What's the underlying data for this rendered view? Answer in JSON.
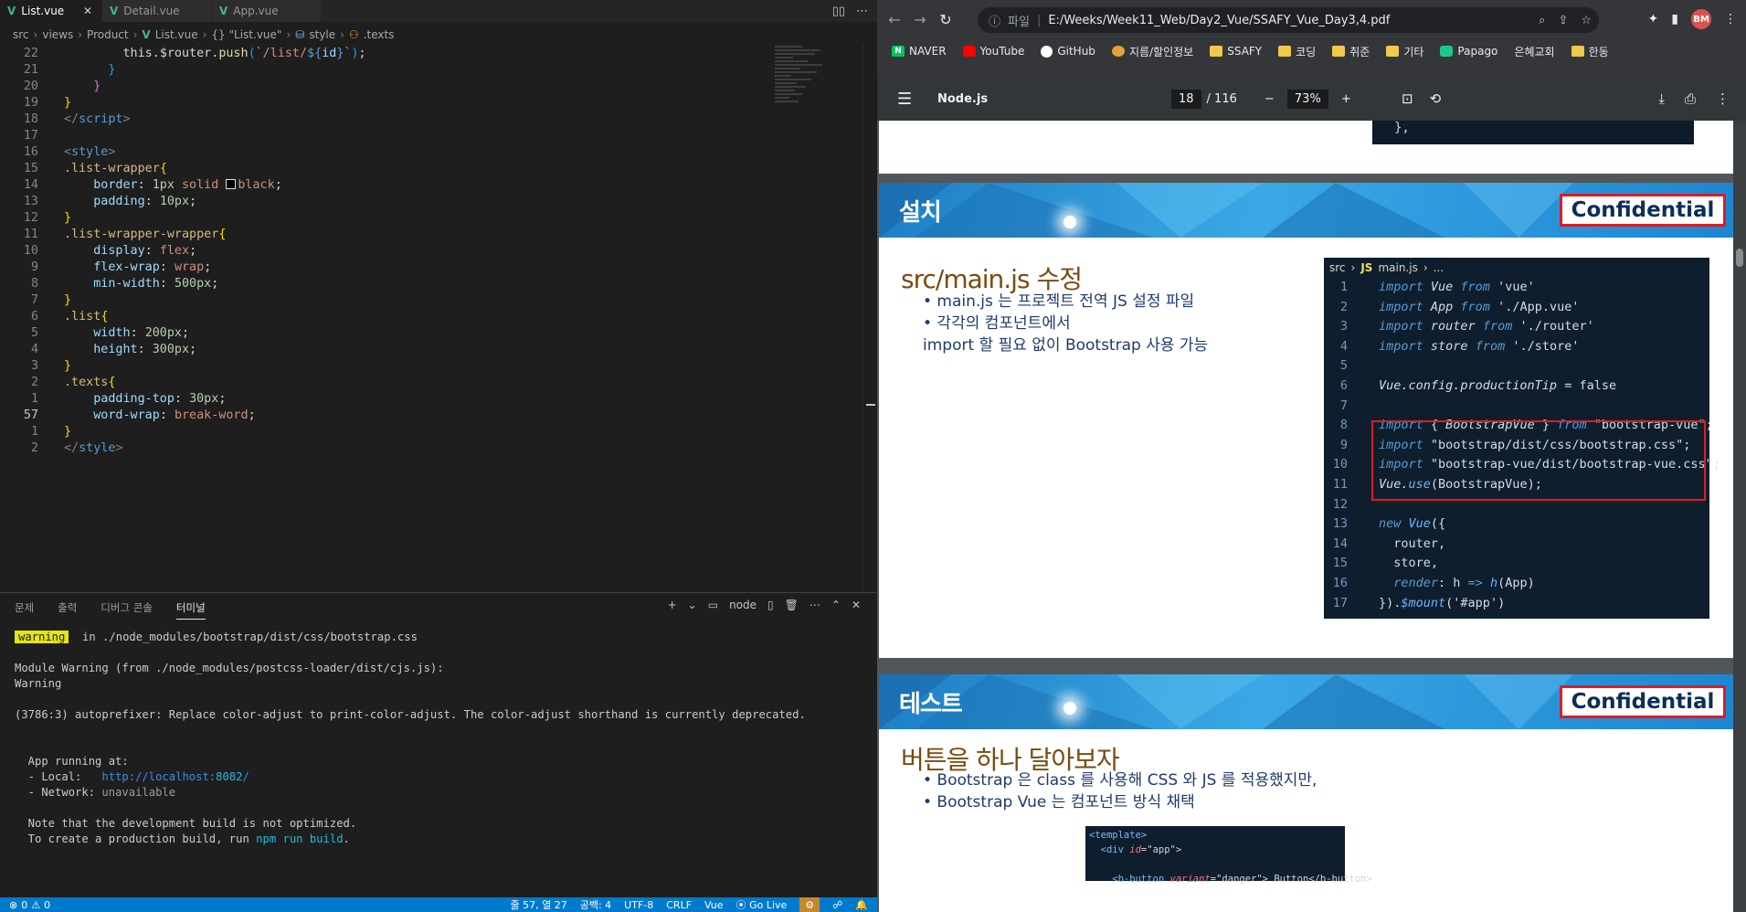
{
  "vscode": {
    "tabs": [
      {
        "label": "List.vue",
        "active": true
      },
      {
        "label": "Detail.vue",
        "active": false
      },
      {
        "label": "App.vue",
        "active": false
      }
    ],
    "tab_actions": [
      "split-editor-icon",
      "more-icon"
    ],
    "breadcrumb": {
      "parts": [
        "src",
        "views",
        "Product",
        "List.vue",
        "{} \"List.vue\"",
        "style",
        ".texts"
      ]
    },
    "code_lines": [
      {
        "ln": "22",
        "segments": [
          [
            "",
            "        "
          ],
          [
            "c-punc",
            "this"
          ],
          [
            "c-punc",
            "."
          ],
          [
            "c-punc",
            "$router"
          ],
          [
            "c-punc",
            "."
          ],
          [
            "c-fn",
            "push"
          ],
          [
            "c-b3",
            "("
          ],
          [
            "c-str",
            "`/list/"
          ],
          [
            "c-kw",
            "${"
          ],
          [
            "c-prop",
            "id"
          ],
          [
            "c-kw",
            "}"
          ],
          [
            "c-str",
            "`"
          ],
          [
            "c-b3",
            ")"
          ],
          [
            "c-punc",
            ";"
          ]
        ]
      },
      {
        "ln": "21",
        "segments": [
          [
            "",
            "      "
          ],
          [
            "c-b3",
            "}"
          ]
        ]
      },
      {
        "ln": "20",
        "segments": [
          [
            "",
            "    "
          ],
          [
            "c-b2",
            "}"
          ]
        ]
      },
      {
        "ln": "19",
        "segments": [
          [
            "c-b1",
            "}"
          ]
        ]
      },
      {
        "ln": "18",
        "segments": [
          [
            "c-tag",
            "</"
          ],
          [
            "c-tagname",
            "script"
          ],
          [
            "c-tag",
            ">"
          ]
        ]
      },
      {
        "ln": "17",
        "segments": []
      },
      {
        "ln": "16",
        "segments": [
          [
            "c-tag",
            "<"
          ],
          [
            "c-tagname",
            "style"
          ],
          [
            "c-tag",
            ">"
          ]
        ]
      },
      {
        "ln": "15",
        "segments": [
          [
            "c-sel",
            ".list-wrapper"
          ],
          [
            "c-b1",
            "{"
          ]
        ]
      },
      {
        "ln": "14",
        "segments": [
          [
            "",
            "    "
          ],
          [
            "c-prop",
            "border"
          ],
          [
            "c-punc",
            ": "
          ],
          [
            "c-num",
            "1px"
          ],
          [
            "c-val",
            " solid "
          ],
          [
            "swatch",
            ""
          ],
          [
            "c-val",
            "black"
          ],
          [
            "c-punc",
            ";"
          ]
        ]
      },
      {
        "ln": "13",
        "segments": [
          [
            "",
            "    "
          ],
          [
            "c-prop",
            "padding"
          ],
          [
            "c-punc",
            ": "
          ],
          [
            "c-num",
            "10px"
          ],
          [
            "c-punc",
            ";"
          ]
        ]
      },
      {
        "ln": "12",
        "segments": [
          [
            "c-b1",
            "}"
          ]
        ]
      },
      {
        "ln": "11",
        "segments": [
          [
            "c-sel",
            ".list-wrapper-wrapper"
          ],
          [
            "c-b1",
            "{"
          ]
        ]
      },
      {
        "ln": "10",
        "segments": [
          [
            "",
            "    "
          ],
          [
            "c-prop",
            "display"
          ],
          [
            "c-punc",
            ": "
          ],
          [
            "c-val",
            "flex"
          ],
          [
            "c-punc",
            ";"
          ]
        ]
      },
      {
        "ln": "9",
        "segments": [
          [
            "",
            "    "
          ],
          [
            "c-prop",
            "flex-wrap"
          ],
          [
            "c-punc",
            ": "
          ],
          [
            "c-val",
            "wrap"
          ],
          [
            "c-punc",
            ";"
          ]
        ]
      },
      {
        "ln": "8",
        "segments": [
          [
            "",
            "    "
          ],
          [
            "c-prop",
            "min-width"
          ],
          [
            "c-punc",
            ": "
          ],
          [
            "c-num",
            "500px"
          ],
          [
            "c-punc",
            ";"
          ]
        ]
      },
      {
        "ln": "7",
        "segments": [
          [
            "c-b1",
            "}"
          ]
        ]
      },
      {
        "ln": "6",
        "segments": [
          [
            "c-sel",
            ".list"
          ],
          [
            "c-b1",
            "{"
          ]
        ]
      },
      {
        "ln": "5",
        "segments": [
          [
            "",
            "    "
          ],
          [
            "c-prop",
            "width"
          ],
          [
            "c-punc",
            ": "
          ],
          [
            "c-num",
            "200px"
          ],
          [
            "c-punc",
            ";"
          ]
        ]
      },
      {
        "ln": "4",
        "segments": [
          [
            "",
            "    "
          ],
          [
            "c-prop",
            "height"
          ],
          [
            "c-punc",
            ": "
          ],
          [
            "c-num",
            "300px"
          ],
          [
            "c-punc",
            ";"
          ]
        ]
      },
      {
        "ln": "3",
        "segments": [
          [
            "c-b1",
            "}"
          ]
        ]
      },
      {
        "ln": "2",
        "segments": [
          [
            "c-sel",
            ".texts"
          ],
          [
            "c-b1",
            "{"
          ]
        ]
      },
      {
        "ln": "1",
        "segments": [
          [
            "",
            "    "
          ],
          [
            "c-prop",
            "padding-top"
          ],
          [
            "c-punc",
            ": "
          ],
          [
            "c-num",
            "30px"
          ],
          [
            "c-punc",
            ";"
          ]
        ]
      },
      {
        "ln": "57",
        "current": true,
        "segments": [
          [
            "",
            "    "
          ],
          [
            "c-prop",
            "word-wrap"
          ],
          [
            "c-punc",
            ": "
          ],
          [
            "c-val",
            "break-word"
          ],
          [
            "c-punc",
            ";"
          ]
        ]
      },
      {
        "ln": "1",
        "segments": [
          [
            "c-b1",
            "}"
          ]
        ]
      },
      {
        "ln": "2",
        "segments": [
          [
            "c-tag",
            "</"
          ],
          [
            "c-tagname",
            "style"
          ],
          [
            "c-tag",
            ">"
          ]
        ]
      }
    ],
    "panel": {
      "tabs": [
        "문제",
        "출력",
        "디버그 콘솔",
        "터미널"
      ],
      "active_tab": "터미널",
      "terminal_name": "node",
      "lines": [
        [
          [
            "warn-badge",
            "warning"
          ],
          [
            "",
            "  in ./node_modules/bootstrap/dist/css/bootstrap.css"
          ]
        ],
        [],
        [
          [
            "",
            "Module Warning (from ./node_modules/postcss-loader/dist/cjs.js):"
          ]
        ],
        [
          [
            "",
            "Warning"
          ]
        ],
        [],
        [
          [
            "",
            "(3786:3) autoprefixer: Replace color-adjust to print-color-adjust. The color-adjust shorthand is currently deprecated."
          ]
        ],
        [],
        [],
        [
          [
            "",
            "  App running at:"
          ]
        ],
        [
          [
            "",
            "  - Local:   "
          ],
          [
            "t-link",
            "http://localhost:"
          ],
          [
            "t-cyan",
            "8082"
          ],
          [
            "t-link",
            "/"
          ]
        ],
        [
          [
            "",
            "  - Network: "
          ],
          [
            "t-dim",
            "unavailable"
          ]
        ],
        [],
        [
          [
            "",
            "  Note that the development build is not optimized."
          ]
        ],
        [
          [
            "",
            "  To create a production build, run "
          ],
          [
            "t-cyan",
            "npm run build"
          ],
          [
            "",
            "."
          ]
        ]
      ]
    },
    "status": {
      "errors": "0",
      "warnings": "0",
      "position": "줄 57, 열 27",
      "spaces": "공백: 4",
      "encoding": "UTF-8",
      "eol": "CRLF",
      "language": "Vue",
      "golive": "Go Live"
    }
  },
  "chrome": {
    "omnibox": {
      "file_label": "파일",
      "url": "E:/Weeks/Week11_Web/Day2_Vue/SSAFY_Vue_Day3,4.pdf"
    },
    "avatar": "BM",
    "bookmarks": [
      {
        "label": "NAVER",
        "icon": "naver"
      },
      {
        "label": "YouTube",
        "icon": "yt"
      },
      {
        "label": "GitHub",
        "icon": "gh"
      },
      {
        "label": "지름/할인정보",
        "icon": "deal"
      },
      {
        "label": "SSAFY",
        "icon": "folder"
      },
      {
        "label": "코딩",
        "icon": "folder"
      },
      {
        "label": "취준",
        "icon": "folder"
      },
      {
        "label": "기타",
        "icon": "folder"
      },
      {
        "label": "Papago",
        "icon": "papago"
      },
      {
        "label": "은혜교회",
        "icon": ""
      },
      {
        "label": "한동",
        "icon": "folder"
      }
    ],
    "pdf": {
      "title": "Node.js",
      "page": "18",
      "total": "/ 116",
      "zoom": "73%"
    },
    "prev_slide_code": "},",
    "slide1": {
      "header": "설치",
      "confidential": "Confidential",
      "title": "src/main.js 수정",
      "bullets": [
        "• main.js 는 프로젝트 전역 JS 설정 파일",
        "• 각각의 컴포넌트에서",
        "   import 할 필요 없이 Bootstrap 사용 가능"
      ],
      "code_header": [
        "src",
        "JS",
        "main.js",
        "..."
      ],
      "code": [
        {
          "ln": "1",
          "parts": [
            [
              "k-imp",
              "import "
            ],
            [
              "k-id",
              "Vue "
            ],
            [
              "k-imp",
              "from "
            ],
            [
              "k-str",
              "'vue'"
            ]
          ]
        },
        {
          "ln": "2",
          "parts": [
            [
              "k-imp",
              "import "
            ],
            [
              "k-id",
              "App "
            ],
            [
              "k-imp",
              "from "
            ],
            [
              "k-str",
              "'./App.vue'"
            ]
          ]
        },
        {
          "ln": "3",
          "parts": [
            [
              "k-imp",
              "import "
            ],
            [
              "k-id",
              "router "
            ],
            [
              "k-imp",
              "from "
            ],
            [
              "k-str",
              "'./router'"
            ]
          ]
        },
        {
          "ln": "4",
          "parts": [
            [
              "k-imp",
              "import "
            ],
            [
              "k-id",
              "store "
            ],
            [
              "k-imp",
              "from "
            ],
            [
              "k-str",
              "'./store'"
            ]
          ]
        },
        {
          "ln": "5",
          "parts": []
        },
        {
          "ln": "6",
          "parts": [
            [
              "k-id",
              "Vue.config.productionTip "
            ],
            [
              "k-str",
              "= false"
            ]
          ]
        },
        {
          "ln": "7",
          "parts": []
        },
        {
          "ln": "8",
          "parts": [
            [
              "k-imp",
              "import "
            ],
            [
              "k-str",
              "{ "
            ],
            [
              "k-id",
              "BootstrapVue "
            ],
            [
              "k-str",
              "} "
            ],
            [
              "k-imp",
              "from "
            ],
            [
              "k-str",
              "\"bootstrap-vue\";"
            ]
          ]
        },
        {
          "ln": "9",
          "parts": [
            [
              "k-imp",
              "import "
            ],
            [
              "k-str",
              "\"bootstrap/dist/css/bootstrap.css\";"
            ]
          ]
        },
        {
          "ln": "10",
          "parts": [
            [
              "k-imp",
              "import "
            ],
            [
              "k-str",
              "\"bootstrap-vue/dist/bootstrap-vue.css\";"
            ]
          ]
        },
        {
          "ln": "11",
          "parts": [
            [
              "k-id",
              "Vue."
            ],
            [
              "k-fn",
              "use"
            ],
            [
              "k-str",
              "(BootstrapVue);"
            ]
          ]
        },
        {
          "ln": "12",
          "parts": []
        },
        {
          "ln": "13",
          "parts": [
            [
              "k-imp",
              "new "
            ],
            [
              "k-fn",
              "Vue"
            ],
            [
              "k-str",
              "({"
            ]
          ]
        },
        {
          "ln": "14",
          "parts": [
            [
              "k-str",
              "  router,"
            ]
          ]
        },
        {
          "ln": "15",
          "parts": [
            [
              "k-str",
              "  store,"
            ]
          ]
        },
        {
          "ln": "16",
          "parts": [
            [
              "k-imp",
              "  render"
            ],
            [
              "k-str",
              ": h "
            ],
            [
              "k-imp",
              "=> "
            ],
            [
              "k-fn",
              "h"
            ],
            [
              "k-str",
              "(App)"
            ]
          ]
        },
        {
          "ln": "17",
          "parts": [
            [
              "k-str",
              "})."
            ],
            [
              "k-fn",
              "$mount"
            ],
            [
              "k-str",
              "('#app')"
            ]
          ]
        }
      ]
    },
    "slide2": {
      "header": "테스트",
      "confidential": "Confidential",
      "title": "버튼을 하나 달아보자",
      "bullets": [
        "• Bootstrap 은 class 를 사용해 CSS 와 JS 를 적용했지만,",
        "• Bootstrap Vue 는 컴포넌트 방식 채택"
      ],
      "code_lines": [
        [
          [
            "c2-tag",
            "<template>"
          ]
        ],
        [
          [
            "",
            "  "
          ],
          [
            "c2-tag",
            "<div "
          ],
          [
            "c2-attr",
            "id"
          ],
          [
            "",
            "=\"app\">"
          ]
        ],
        [],
        [
          [
            "",
            "    "
          ],
          [
            "c2-tag",
            "<b-button "
          ],
          [
            "c2-attr",
            "variant"
          ],
          [
            "",
            "=\"danger\"> Button</b-button>"
          ]
        ]
      ]
    }
  }
}
